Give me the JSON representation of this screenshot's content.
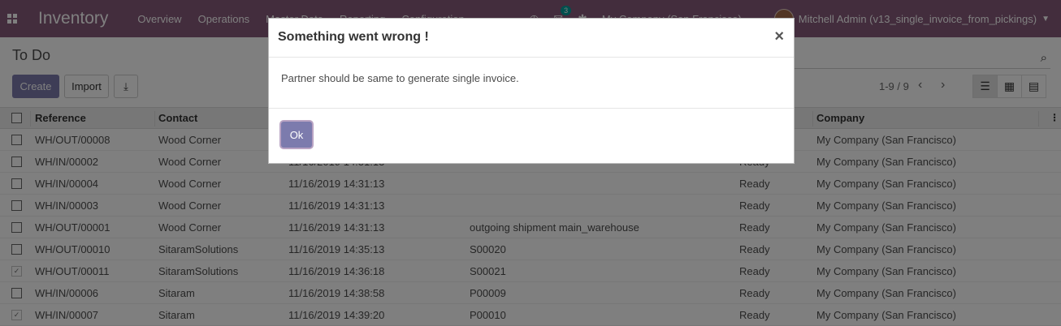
{
  "navbar": {
    "brand": "Inventory",
    "menu": [
      "Overview",
      "Operations",
      "Master Data",
      "Reporting",
      "Configuration"
    ],
    "message_count": "3",
    "company": "My Company (San Francisco)",
    "user": "Mitchell Admin (v13_single_invoice_from_pickings)",
    "accent_color": "#875a7b"
  },
  "control_panel": {
    "breadcrumb": "To Do",
    "create_label": "Create",
    "import_label": "Import",
    "pager": "1-9 / 9"
  },
  "table": {
    "headers": [
      "Reference",
      "Contact",
      "Company"
    ],
    "rows": [
      {
        "ref": "WH/OUT/00008",
        "contact": "Wood Corner",
        "date": "",
        "origin": "",
        "status": "",
        "company": "My Company (San Francisco)",
        "checked": false
      },
      {
        "ref": "WH/IN/00002",
        "contact": "Wood Corner",
        "date": "11/16/2019 14:31:13",
        "origin": "",
        "status": "Ready",
        "company": "My Company (San Francisco)",
        "checked": false
      },
      {
        "ref": "WH/IN/00004",
        "contact": "Wood Corner",
        "date": "11/16/2019 14:31:13",
        "origin": "",
        "status": "Ready",
        "company": "My Company (San Francisco)",
        "checked": false
      },
      {
        "ref": "WH/IN/00003",
        "contact": "Wood Corner",
        "date": "11/16/2019 14:31:13",
        "origin": "",
        "status": "Ready",
        "company": "My Company (San Francisco)",
        "checked": false
      },
      {
        "ref": "WH/OUT/00001",
        "contact": "Wood Corner",
        "date": "11/16/2019 14:31:13",
        "origin": "outgoing shipment main_warehouse",
        "status": "Ready",
        "company": "My Company (San Francisco)",
        "checked": false
      },
      {
        "ref": "WH/OUT/00010",
        "contact": "SitaramSolutions",
        "date": "11/16/2019 14:35:13",
        "origin": "S00020",
        "status": "Ready",
        "company": "My Company (San Francisco)",
        "checked": false
      },
      {
        "ref": "WH/OUT/00011",
        "contact": "SitaramSolutions",
        "date": "11/16/2019 14:36:18",
        "origin": "S00021",
        "status": "Ready",
        "company": "My Company (San Francisco)",
        "checked": true
      },
      {
        "ref": "WH/IN/00006",
        "contact": "Sitaram",
        "date": "11/16/2019 14:38:58",
        "origin": "P00009",
        "status": "Ready",
        "company": "My Company (San Francisco)",
        "checked": false
      },
      {
        "ref": "WH/IN/00007",
        "contact": "Sitaram",
        "date": "11/16/2019 14:39:20",
        "origin": "P00010",
        "status": "Ready",
        "company": "My Company (San Francisco)",
        "checked": true
      }
    ]
  },
  "modal": {
    "title": "Something went wrong !",
    "close": "×",
    "message": "Partner should be same to generate single invoice.",
    "ok_label": "Ok"
  }
}
